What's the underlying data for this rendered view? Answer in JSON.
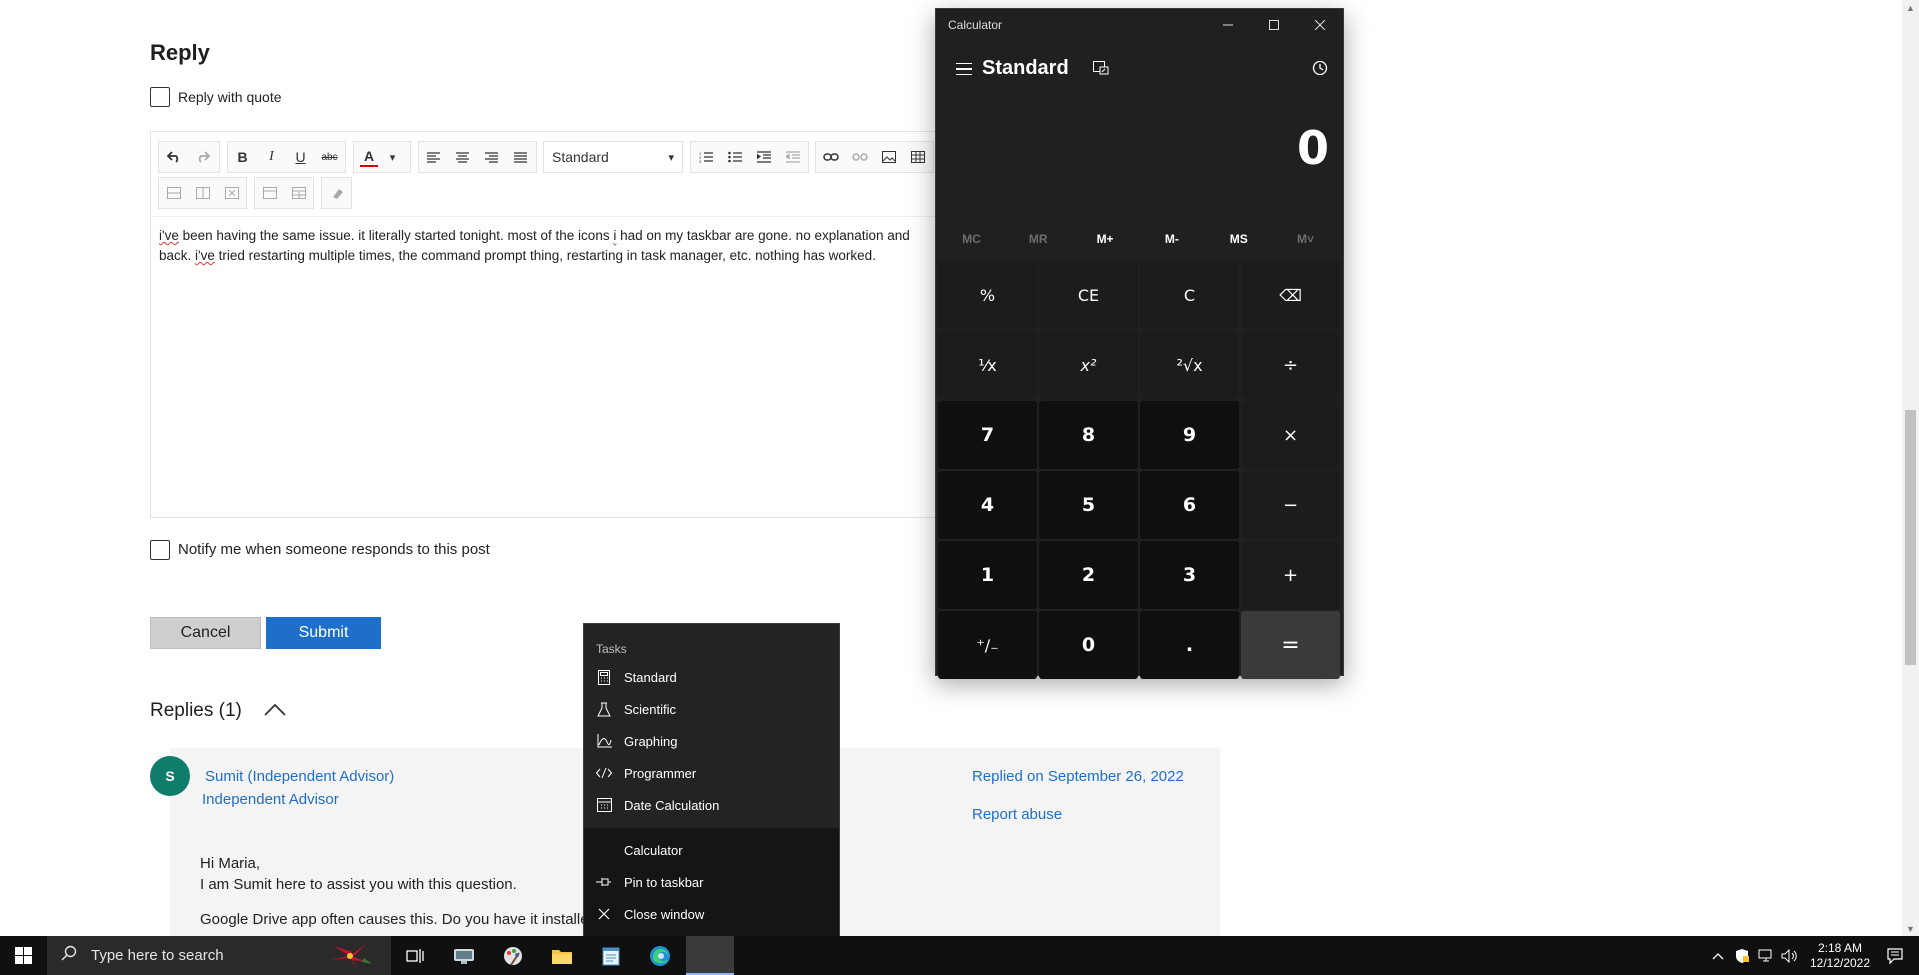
{
  "page": {
    "reply_title": "Reply",
    "reply_with_quote": "Reply with quote",
    "toolbar": {
      "style_select": "Standard",
      "select_arrow": "▾",
      "font_color_label": "A"
    },
    "editor_text": {
      "line1_word1": "i've",
      "line1_rest": " been having the same issue. it literally started tonight. most of the icons ",
      "line1_i": "i",
      "line1_end": " had on my taskbar are gone. no explanation and",
      "line2_start": "back. ",
      "line2_word": "i've",
      "line2_rest": " tried restarting multiple times, the command prompt thing, restarting in task manager, etc. nothing has worked."
    },
    "notify_label": "Notify me when someone responds to this post",
    "cancel_label": "Cancel",
    "submit_label": "Submit",
    "replies_heading": "Replies (1)",
    "reply": {
      "avatar_initial": "S",
      "author": "Sumit (Independent Advisor)",
      "author_role": "Independent Advisor",
      "replied_on": "Replied on September 26, 2022",
      "report_abuse": "Report abuse",
      "line1": "Hi Maria,",
      "line2": "I am Sumit here to assist you with this question.",
      "line3": "Google Drive app often causes this. Do you have it installe"
    }
  },
  "calculator": {
    "window_title": "Calculator",
    "mode": "Standard",
    "display_value": "0",
    "memory_buttons": [
      "MC",
      "MR",
      "M+",
      "M-",
      "MS",
      "M˅"
    ],
    "keys": [
      "%",
      "CE",
      "C",
      "⌫",
      "¹⁄x",
      "x²",
      "²√x",
      "÷",
      "7",
      "8",
      "9",
      "×",
      "4",
      "5",
      "6",
      "−",
      "1",
      "2",
      "3",
      "+",
      "⁺∕₋",
      "0",
      ".",
      "="
    ]
  },
  "jumplist": {
    "section_title": "Tasks",
    "tasks": [
      "Standard",
      "Scientific",
      "Graphing",
      "Programmer",
      "Date Calculation"
    ],
    "app_name": "Calculator",
    "pin_label": "Pin to taskbar",
    "close_label": "Close window"
  },
  "taskbar": {
    "search_placeholder": "Type here to search",
    "time": "2:18 AM",
    "date": "12/12/2022"
  },
  "colors": {
    "accent_blue": "#1e6fc9",
    "avatar_green": "#107c6c",
    "calc_bg": "#202020"
  }
}
